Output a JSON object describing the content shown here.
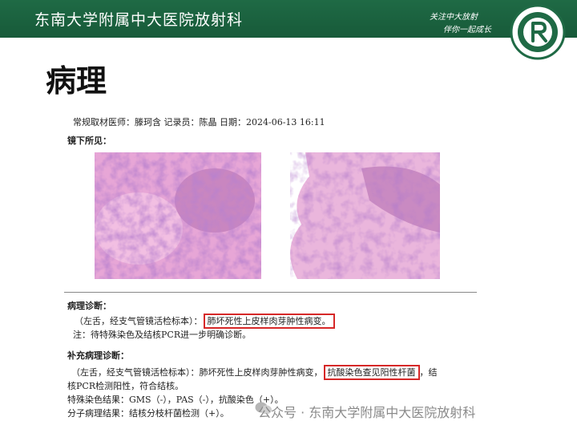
{
  "banner": {
    "title": "东南大学附属中大医院放射科",
    "slogan_line1": "关注中大放射",
    "slogan_line2": "伴你一起成长"
  },
  "heading": "病理",
  "report": {
    "meta": "常规取材医师：滕珂含 记录员：陈晶 日期：2024-06-13 16:11",
    "microscopy_label": "镜下所见：",
    "diagnosis_label": "病理诊断：",
    "diagnosis_prefix": "（左舌，经支气管镜活检标本）：",
    "diagnosis_boxed": "肺坏死性上皮样肉芽肿性病变。",
    "diagnosis_note": "注：待特殊染色及结核PCR进一步明确诊断。",
    "supplement_label": "补充病理诊断：",
    "supplement_prefix": "（左舌，经支气管镜活检标本）：肺坏死性上皮样肉芽肿性病变，",
    "supplement_boxed": "抗酸染色查见阳性杆菌",
    "supplement_suffix": "，结",
    "supplement_line2": "核PCR检测阳性，符合结核。",
    "special_stain": "特殊染色结果：GMS（-），PAS（-），抗酸染色（+）。",
    "molecular": "分子病理结果：结核分枝杆菌检测（+）。"
  },
  "watermark": "公众号 · 东南大学附属中大医院放射科",
  "colors": {
    "banner_green": "#1f6a45",
    "highlight_red": "#d62828",
    "stain_pink": "#d98bc4",
    "stain_purple": "#7a3f9a"
  }
}
